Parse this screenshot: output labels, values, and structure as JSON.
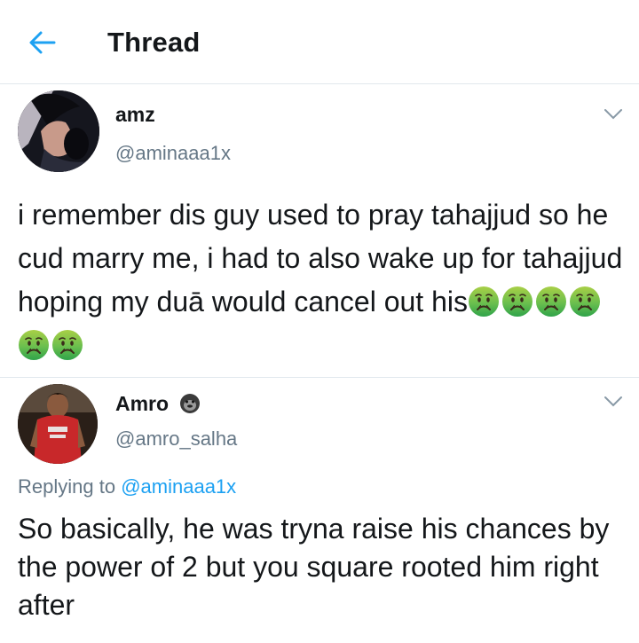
{
  "header": {
    "title": "Thread"
  },
  "icons": {
    "back": "arrow-left-icon",
    "caret": "chevron-down-icon",
    "badge": "gorilla-emoji",
    "reaction": "nauseated-face-emoji"
  },
  "colors": {
    "accent": "#1da1f2",
    "muted": "#657786",
    "divider": "#e1e8ed",
    "text": "#14171a"
  },
  "tweets": [
    {
      "name": "amz",
      "handle": "@aminaaa1x",
      "text": "i remember dis guy used to pray tahajjud so he cud marry me, i had to also wake up for tahajjud hoping my duā would cancel out his",
      "emoji_count": 6
    },
    {
      "name": "Amro",
      "handle": "@amro_salha",
      "reply_prefix": "Replying to",
      "reply_to": "@aminaaa1x",
      "text": "So basically, he was tryna raise his chances by the power of 2 but you square rooted him right after"
    }
  ]
}
